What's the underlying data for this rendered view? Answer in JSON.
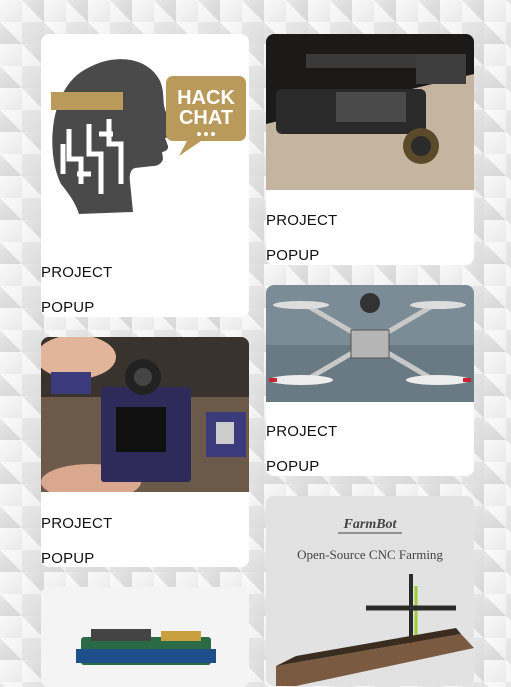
{
  "cards": [
    {
      "title": "PROJECT",
      "subtitle": "POPUP"
    },
    {
      "title": "PROJECT",
      "subtitle": "POPUP"
    },
    {
      "title": "PROJECT",
      "subtitle": "POPUP"
    },
    {
      "title": "PROJECT",
      "subtitle": "POPUP"
    },
    {
      "title": "",
      "subtitle": ""
    },
    {
      "title": "",
      "subtitle": ""
    }
  ],
  "hackchat_logo": {
    "line1": "HACK",
    "line2": "CHAT",
    "dots": "..."
  },
  "farmbot": {
    "logo": "FarmBot",
    "tagline": "Open-Source CNC Farming"
  },
  "colors": {
    "hackchat_gold": "#b99a5a",
    "head_dark": "#4a4a4a",
    "farmbot_bg": "#e2e2e2"
  }
}
